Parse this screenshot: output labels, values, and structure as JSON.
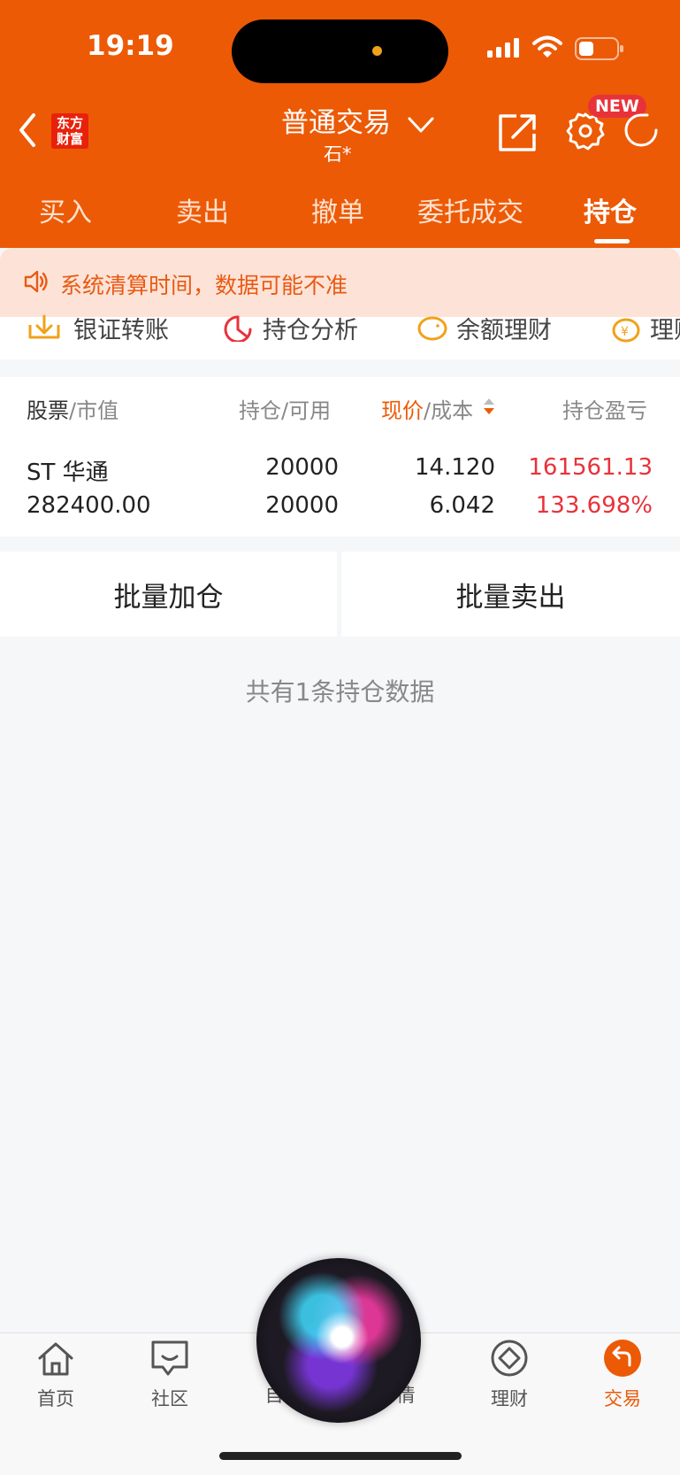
{
  "status_bar": {
    "time": "19:19"
  },
  "header": {
    "logo_line1": "东方",
    "logo_line2": "财富",
    "title": "普通交易",
    "account": "石*",
    "new_badge": "NEW",
    "tabs": [
      {
        "label": "买入"
      },
      {
        "label": "卖出"
      },
      {
        "label": "撤单"
      },
      {
        "label": "委托成交"
      },
      {
        "label": "持仓"
      }
    ]
  },
  "notice": {
    "text": "系统清算时间，数据可能不准"
  },
  "quick_links": [
    {
      "label": "银证转账",
      "icon": "download-tray-icon"
    },
    {
      "label": "持仓分析",
      "icon": "pie-chart-icon"
    },
    {
      "label": "余额理财",
      "icon": "piggy-bank-icon"
    },
    {
      "label": "理财",
      "icon": "yen-coin-icon"
    }
  ],
  "table": {
    "headers": {
      "col1_primary": "股票",
      "col1_secondary": "市值",
      "col2_primary": "持仓",
      "col2_secondary": "可用",
      "col3_primary": "现价",
      "col3_secondary": "成本",
      "col4": "持仓盈亏",
      "sep": "/"
    },
    "rows": [
      {
        "name": "ST 华通",
        "market_value": "282400.00",
        "position": "20000",
        "available": "20000",
        "price": "14.120",
        "cost": "6.042",
        "pnl": "161561.13",
        "pnl_pct": "133.698%"
      }
    ]
  },
  "actions": {
    "batch_add": "批量加仓",
    "batch_sell": "批量卖出"
  },
  "summary": "共有1条持仓数据",
  "bottom_nav": [
    {
      "label": "首页",
      "icon": "home-icon"
    },
    {
      "label": "社区",
      "icon": "chat-icon"
    },
    {
      "label": "自",
      "icon": ""
    },
    {
      "label": "情",
      "icon": ""
    },
    {
      "label": "理财",
      "icon": "diamond-icon"
    },
    {
      "label": "交易",
      "icon": "exchange-icon"
    }
  ],
  "colors": {
    "brand": "#ec5a06",
    "up": "#e8323a",
    "notice_bg": "#fde3d7"
  }
}
